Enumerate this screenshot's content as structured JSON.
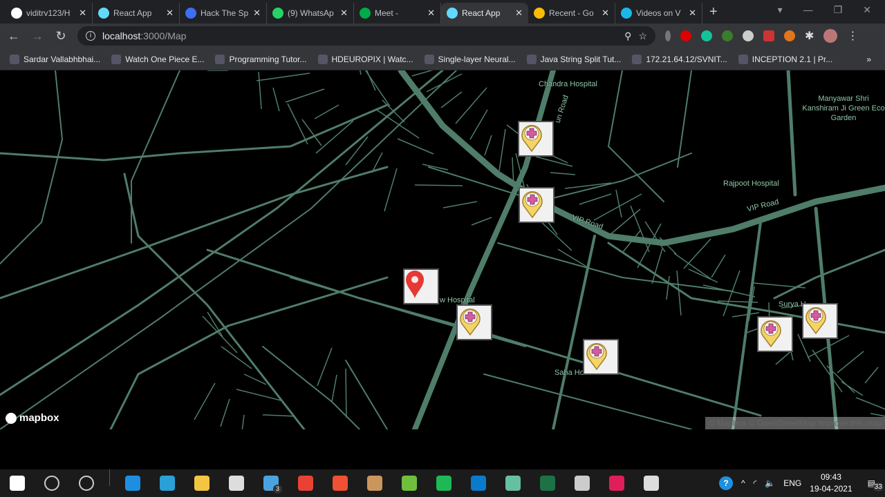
{
  "browser": {
    "tabs": [
      {
        "title": "viditrv123/H",
        "icon": "github-icon",
        "color": "#ffffff"
      },
      {
        "title": "React App",
        "icon": "react-icon",
        "color": "#61dafb"
      },
      {
        "title": "Hack The Sp",
        "icon": "hack-icon",
        "color": "#3b6ff5"
      },
      {
        "title": "(9) WhatsAp",
        "icon": "whatsapp-icon",
        "color": "#25d366"
      },
      {
        "title": "Meet -",
        "icon": "meet-icon",
        "color": "#00ac47"
      },
      {
        "title": "React App",
        "icon": "react-icon",
        "color": "#61dafb",
        "active": true
      },
      {
        "title": "Recent - Go",
        "icon": "drive-icon",
        "color": "#fbbc04"
      },
      {
        "title": "Videos on V",
        "icon": "vimeo-icon",
        "color": "#1ab7ea"
      }
    ],
    "url_host": "localhost",
    "url_path": ":3000/Map",
    "bookmarks": [
      {
        "label": "Sardar Vallabhbhai..."
      },
      {
        "label": "Watch One Piece E..."
      },
      {
        "label": "Programming Tutor..."
      },
      {
        "label": "HDEUROPIX | Watc..."
      },
      {
        "label": "Single-layer Neural..."
      },
      {
        "label": "Java String Split Tut..."
      },
      {
        "label": "172.21.64.12/SVNIT..."
      },
      {
        "label": "INCEPTION 2.1 | Pr..."
      }
    ],
    "bookmarks_more": "»"
  },
  "map": {
    "labels": {
      "chandra": "Chandra Hospital",
      "garden": "Manyawar Shri Kanshiram Ji Green Eco Garden",
      "rajpoot": "Rajpoot Hospital",
      "vip1": "VIP Road",
      "vip2": "VIP Road",
      "road": "un Road",
      "hosp": "w Hospital",
      "surya": "Surya H",
      "saha": "Saha Hos"
    },
    "logo": "mapbox",
    "attribution": "© Mapbox © OpenStreetMap  Improve this map",
    "road_color": "#4f7d69",
    "hospital_marker_count": 6
  },
  "taskbar": {
    "mail_badge": "3",
    "lang": "ENG",
    "time": "09:43",
    "date": "19-04-2021",
    "notifications": "33"
  }
}
